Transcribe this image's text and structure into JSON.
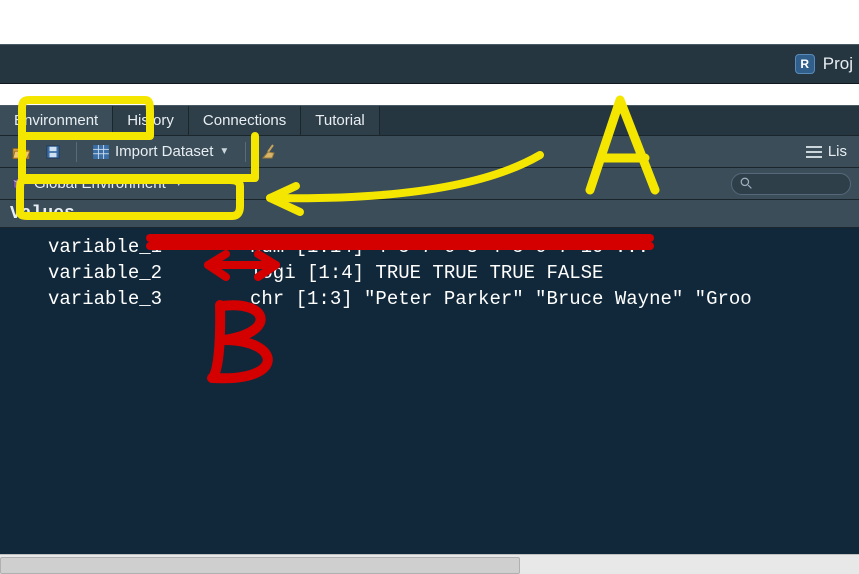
{
  "project_bar": {
    "label": "Proj"
  },
  "tabs": [
    {
      "label": "Environment",
      "active": true
    },
    {
      "label": "History",
      "active": false
    },
    {
      "label": "Connections",
      "active": false
    },
    {
      "label": "Tutorial",
      "active": false
    }
  ],
  "toolbar": {
    "import_label": "Import Dataset",
    "list_label": "Lis"
  },
  "scope": {
    "label": "Global Environment"
  },
  "section_header": "Values",
  "variables": [
    {
      "name": "variable_1",
      "value": "num [1:14] 4 5 7 6 5 4 5 6 7 10 ..."
    },
    {
      "name": "variable_2",
      "value": "logi [1:4] TRUE TRUE TRUE FALSE"
    },
    {
      "name": "variable_3",
      "value": "chr [1:3] \"Peter Parker\" \"Bruce Wayne\" \"Groo"
    }
  ],
  "annotations": {
    "A": "A",
    "B": "B"
  }
}
